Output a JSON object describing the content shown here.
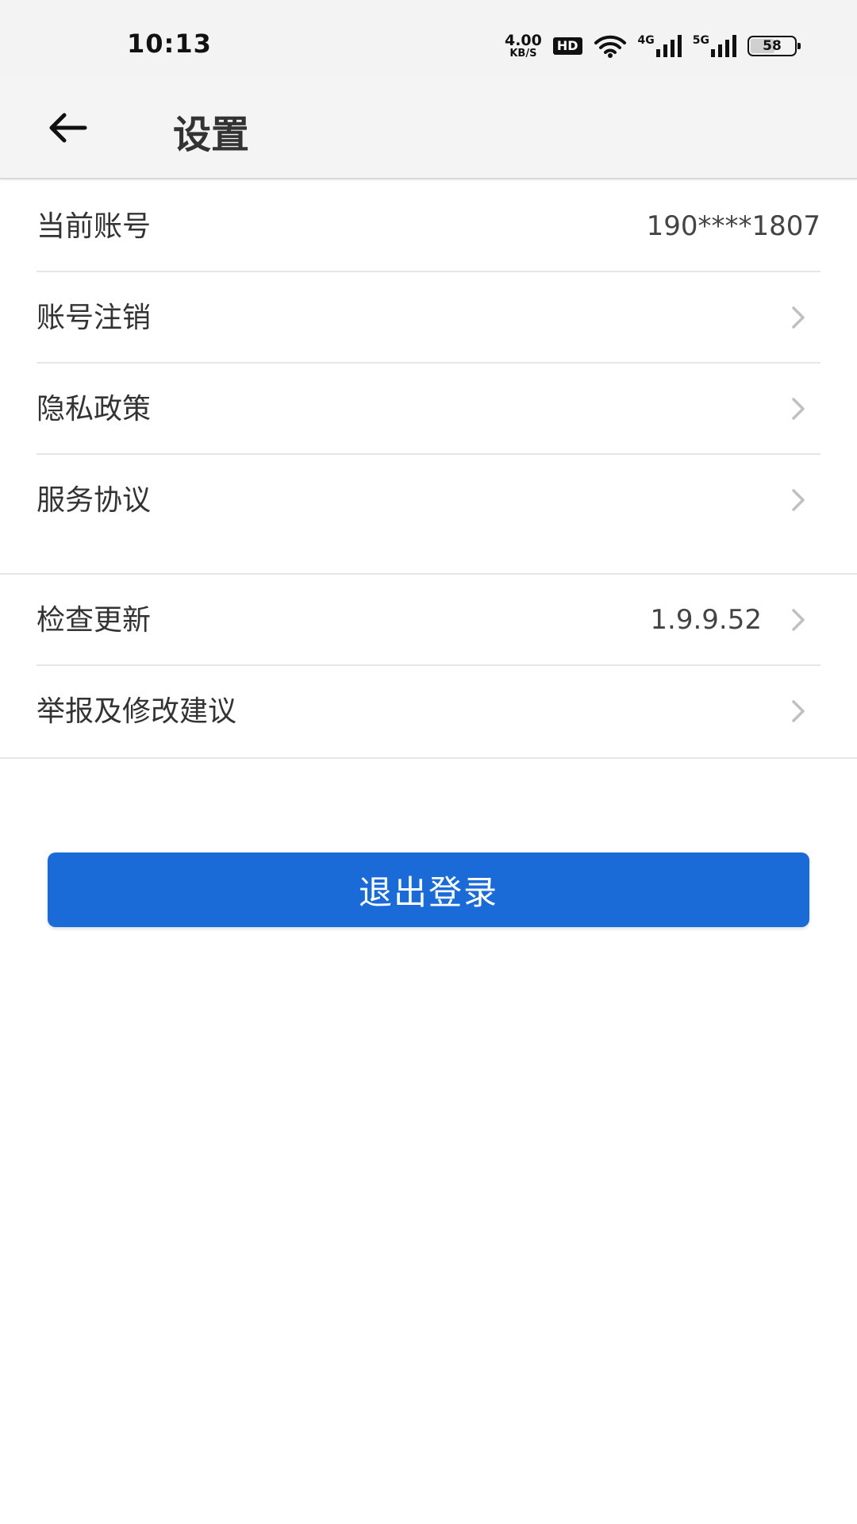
{
  "status_bar": {
    "time": "10:13",
    "net_speed_value": "4.00",
    "net_speed_unit": "KB/S",
    "hd_label": "HD",
    "signal_1_label": "4G",
    "signal_2_label": "5G",
    "battery_level": "58",
    "battery_fraction": 0.58,
    "icons": [
      "wifi-icon",
      "signal-4g-icon",
      "signal-5g-icon",
      "battery-icon"
    ]
  },
  "header": {
    "back_icon": "arrow-left-icon",
    "title": "设置"
  },
  "account_section": {
    "items": [
      {
        "label": "当前账号",
        "value": "190****1807",
        "chevron": false
      },
      {
        "label": "账号注销",
        "chevron": true
      },
      {
        "label": "隐私政策",
        "chevron": true
      },
      {
        "label": "服务协议",
        "chevron": true
      }
    ]
  },
  "app_section": {
    "items": [
      {
        "label": "检查更新",
        "value": "1.9.9.52",
        "chevron": true
      },
      {
        "label": "举报及修改建议",
        "chevron": true
      }
    ]
  },
  "logout_button": {
    "label": "退出登录"
  },
  "colors": {
    "primary": "#1a6bd8",
    "header_bg": "#f4f4f4",
    "divider": "#e6e6e6",
    "text": "#333333",
    "chevron": "#c0c0c0"
  }
}
